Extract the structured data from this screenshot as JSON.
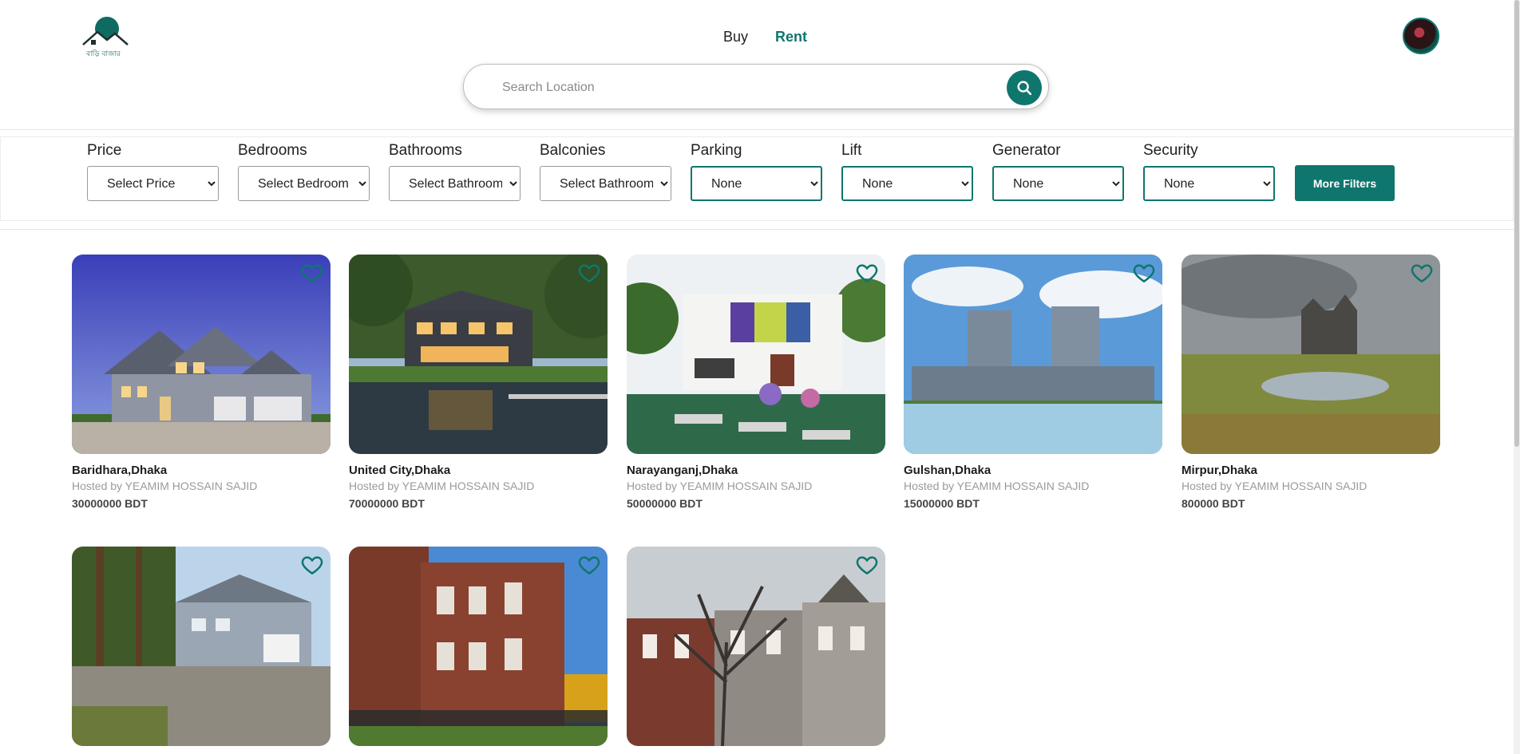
{
  "header": {
    "logo_text": "বাড়ি বাজার",
    "nav": [
      {
        "label": "Buy",
        "active": false
      },
      {
        "label": "Rent",
        "active": true
      }
    ],
    "search_placeholder": "Search Location"
  },
  "filters": [
    {
      "label": "Price",
      "value": "Select Price"
    },
    {
      "label": "Bedrooms",
      "value": "Select Bedroom"
    },
    {
      "label": "Bathrooms",
      "value": "Select Bathroom"
    },
    {
      "label": "Balconies",
      "value": "Select Bathroom"
    },
    {
      "label": "Parking",
      "value": "None"
    },
    {
      "label": "Lift",
      "value": "None"
    },
    {
      "label": "Generator",
      "value": "None"
    },
    {
      "label": "Security",
      "value": "None"
    }
  ],
  "more_filters_label": "More Filters",
  "listings": [
    {
      "title": "Baridhara,Dhaka",
      "host": "Hosted by YEAMIM HOSSAIN SAJID",
      "price": "30000000 BDT"
    },
    {
      "title": "United City,Dhaka",
      "host": "Hosted by YEAMIM HOSSAIN SAJID",
      "price": "70000000 BDT"
    },
    {
      "title": "Narayanganj,Dhaka",
      "host": "Hosted by YEAMIM HOSSAIN SAJID",
      "price": "50000000 BDT"
    },
    {
      "title": "Gulshan,Dhaka",
      "host": "Hosted by YEAMIM HOSSAIN SAJID",
      "price": "15000000 BDT"
    },
    {
      "title": "Mirpur,Dhaka",
      "host": "Hosted by YEAMIM HOSSAIN SAJID",
      "price": "800000 BDT"
    },
    {
      "title": "",
      "host": "",
      "price": ""
    },
    {
      "title": "",
      "host": "",
      "price": ""
    },
    {
      "title": "",
      "host": "",
      "price": ""
    }
  ],
  "colors": {
    "accent": "#0f766e"
  },
  "icons": {
    "search": "search-icon",
    "favorite": "heart-outline-icon"
  }
}
